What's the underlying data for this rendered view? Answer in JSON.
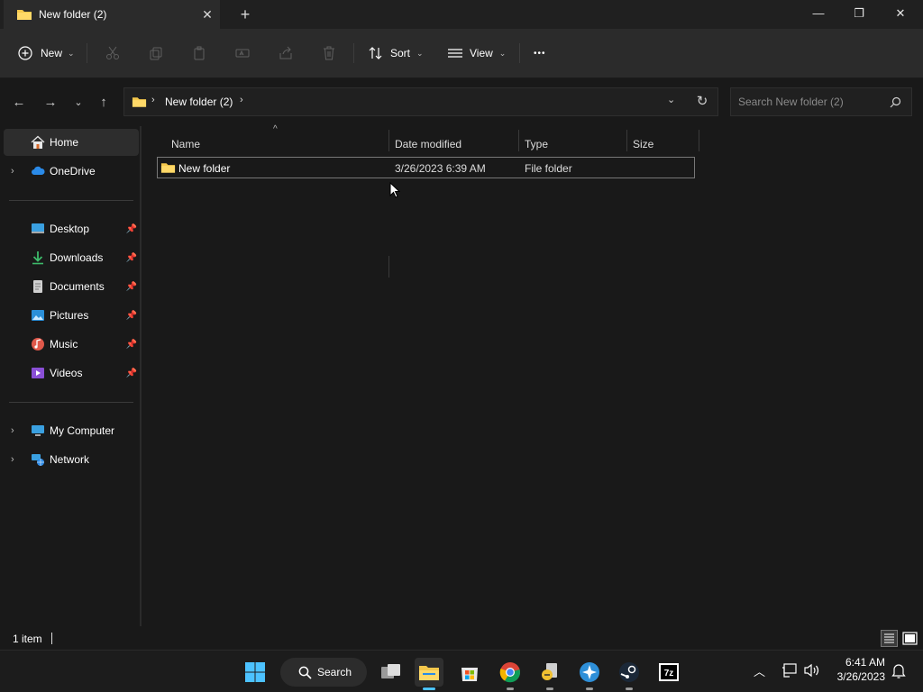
{
  "window": {
    "tab_title": "New folder (2)",
    "tab_close_glyph": "✕",
    "new_tab_glyph": "+",
    "minimize_glyph": "—",
    "maximize_glyph": "❐",
    "close_glyph": "✕"
  },
  "toolbar": {
    "new_label": "New",
    "sort_label": "Sort",
    "view_label": "View",
    "more_glyph": "•••"
  },
  "address": {
    "path_segment": "New folder (2)",
    "search_placeholder": "Search New folder (2)"
  },
  "sidebar": {
    "home": "Home",
    "onedrive": "OneDrive",
    "desktop": "Desktop",
    "downloads": "Downloads",
    "documents": "Documents",
    "pictures": "Pictures",
    "music": "Music",
    "videos": "Videos",
    "my_computer": "My Computer",
    "network": "Network"
  },
  "columns": {
    "name": "Name",
    "date_modified": "Date modified",
    "type": "Type",
    "size": "Size"
  },
  "files": [
    {
      "name": "New folder",
      "date_modified": "3/26/2023 6:39 AM",
      "type": "File folder",
      "size": ""
    }
  ],
  "status": {
    "item_count": "1 item"
  },
  "taskbar": {
    "search_label": "Search",
    "time": "6:41 AM",
    "date": "3/26/2023"
  },
  "colors": {
    "accent": "#4cc2ff",
    "folder": "#f5c84c",
    "background": "#191919",
    "toolbar": "#2b2b2b"
  }
}
